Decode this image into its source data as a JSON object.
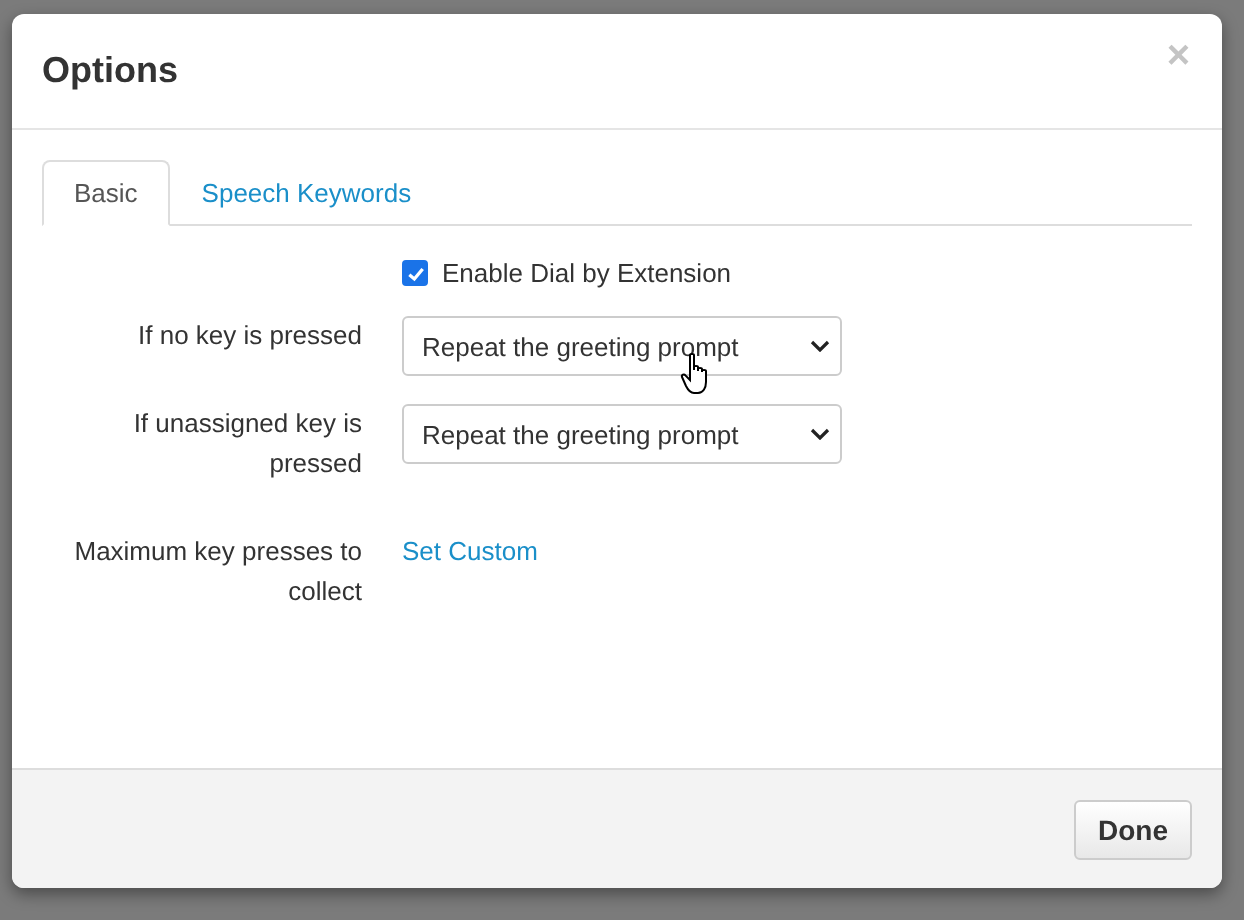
{
  "dialog": {
    "title": "Options",
    "close": "×"
  },
  "tabs": [
    {
      "label": "Basic",
      "selected": true
    },
    {
      "label": "Speech Keywords",
      "selected": false
    }
  ],
  "checkbox": {
    "label": "Enable Dial by Extension",
    "checked": true
  },
  "fields": [
    {
      "kind": "select",
      "label": "If no key is pressed",
      "value": "Repeat the greeting prompt"
    },
    {
      "kind": "select",
      "label": "If unassigned key is pressed",
      "value": "Repeat the greeting prompt"
    },
    {
      "kind": "link",
      "label": "Maximum key presses to collect",
      "value": "Set Custom"
    }
  ],
  "buttons": [
    "Done"
  ]
}
